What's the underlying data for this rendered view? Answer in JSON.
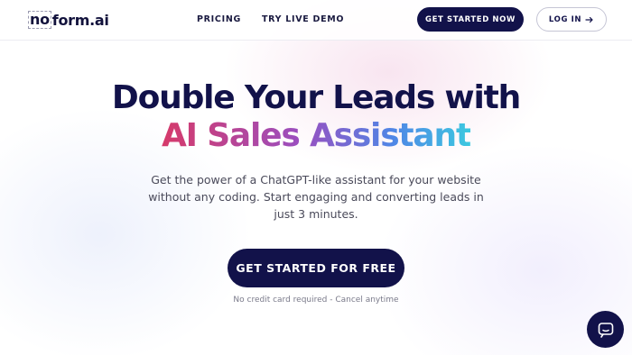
{
  "header": {
    "logo": {
      "part1": "no",
      "part2": "form.ai"
    },
    "nav": [
      {
        "label": "PRICING"
      },
      {
        "label": "TRY LIVE DEMO"
      }
    ],
    "get_started_label": "GET STARTED NOW",
    "login_label": "LOG IN",
    "login_icon": "arrow-right-icon"
  },
  "hero": {
    "title_line1": "Double Your Leads with",
    "title_line2": "AI Sales Assistant",
    "subtitle": "Get the power of a ChatGPT-like assistant for your website without any coding. Start engaging and converting leads in just 3 minutes.",
    "cta_label": "GET STARTED FOR FREE",
    "note": "No credit card required - Cancel anytime"
  },
  "chat_widget": {
    "icon": "chat-bubble-icon"
  },
  "colors": {
    "brand_navy": "#12124a",
    "gradient": [
      "#d63a6a",
      "#9a4fc0",
      "#4f86e6",
      "#3dc8e0"
    ]
  }
}
